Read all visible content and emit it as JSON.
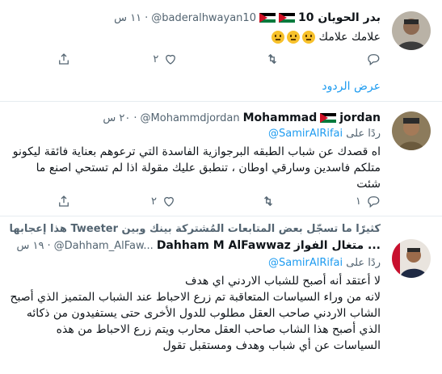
{
  "tweets": [
    {
      "name": "بدر الحويان 10",
      "handle": "@baderalhwayan10",
      "time": "١١ س",
      "text": "علامك علامك",
      "reply_count": "",
      "retweet_count": "",
      "like_count": "٢",
      "show_replies": "عرض الردود"
    },
    {
      "name": "jordan",
      "name_suffix": "Mohammad",
      "handle": "@Mohammdjordan",
      "time": "٢٠ س",
      "replying_prefix": "ردًا على",
      "replying_mention": "@SamirAlRifai",
      "text": "اه قصدك عن شباب الطبقه البرجوازية الفاسدة التي ترعوهم بعناية فائقة ليكونو متلكم فاسدين وسارقي اوطان ، تنطبق عليك مقولة اذا لم تستحي اصنع ما شئت",
      "reply_count": "١",
      "retweet_count": "",
      "like_count": "٢"
    },
    {
      "notice": "كثيرًا ما تسجّل بعض المتابعات المُشتركة بينك وبين Tweeter هذا إعجابها به",
      "name": "Dahham M AlFawwaz",
      "name_ar": "... متغال الفواز",
      "handle": "@Dahham_AlFaw...",
      "time": "١٩ س",
      "replying_prefix": "ردًا على",
      "replying_mention": "@SamirAlRifai",
      "text": "لا أعتقد أنه أصبح للشباب الاردني اي هدف\nلانه من وراء السياسات المتعاقبة تم زرع الاحباط عند الشباب المتميز الذي أصبح الشاب الاردني صاحب العقل مطلوب للدول الأخرى حتى يستفيدون من ذكائه الذي أصبح هذا الشاب صاحب العقل محارب ويتم زرع الاحباط من هذه السياسات عن أي شباب وهدف ومستقبل تقول"
    }
  ]
}
